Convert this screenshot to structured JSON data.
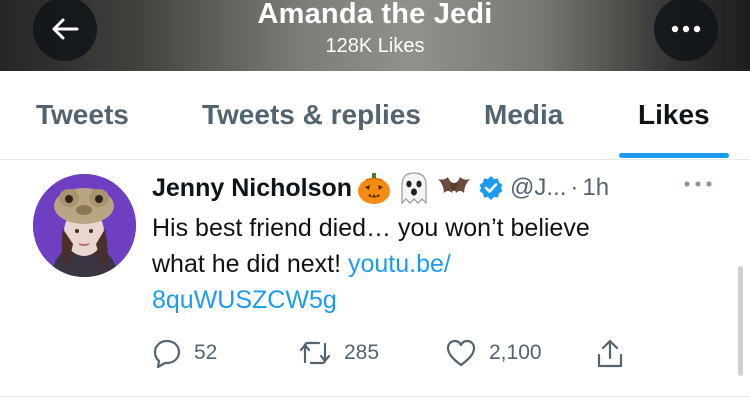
{
  "header": {
    "title": "Amanda the Jedi",
    "subtitle": "128K Likes",
    "back_icon": "arrow-left-icon",
    "more_icon": "more-horizontal-icon"
  },
  "tabs": [
    {
      "label": "Tweets",
      "active": false
    },
    {
      "label": "Tweets & replies",
      "active": false
    },
    {
      "label": "Media",
      "active": false
    },
    {
      "label": "Likes",
      "active": true
    }
  ],
  "tweet": {
    "author_name": "Jenny Nicholson",
    "name_emojis": [
      "jack-o-lantern",
      "ghost",
      "bat"
    ],
    "verified": true,
    "handle": "@J...",
    "separator": "·",
    "time": "1h",
    "text_line1": "His best friend died… you won’t believe",
    "text_line2_plain": "what he did next!",
    "link_part1": "youtu.be/",
    "link_part2": "8quWUSZCW5g",
    "replies": "52",
    "retweets": "285",
    "likes": "2,100"
  },
  "colors": {
    "accent": "#1d9bf0",
    "secondary_text": "#536471",
    "primary_text": "#0f1419"
  }
}
